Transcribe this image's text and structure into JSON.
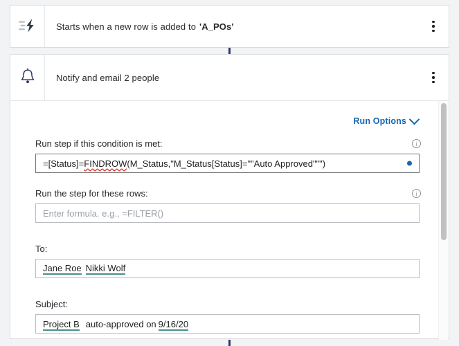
{
  "flow": {
    "steps": [
      {
        "icon": "trigger-bolt-icon",
        "title_prefix": "Starts when a new row is added to",
        "title_bold": "'A_POs'",
        "menu": "more-options"
      },
      {
        "icon": "bell-icon",
        "title_prefix": "Notify and email 2 people",
        "title_bold": "",
        "menu": "more-options"
      }
    ]
  },
  "action_panel": {
    "run_options_label": "Run Options",
    "condition": {
      "label": "Run step if this condition is met:",
      "value_before": "=[Status]=",
      "value_spell": "FINDROW",
      "value_after": "(M_Status,\"M_Status[Status]=\"\"Auto Approved\"\"\")",
      "full_value": "=[Status]=FINDROW(M_Status,\"M_Status[Status]=\"\"Auto Approved\"\"\")",
      "info_tooltip": "info"
    },
    "rows": {
      "label": "Run the step for these rows:",
      "value": "",
      "placeholder": "Enter formula. e.g., =FILTER()",
      "info_tooltip": "info"
    },
    "to": {
      "label": "To:",
      "recipients": [
        "Jane Roe",
        "Nikki Wolf"
      ]
    },
    "subject": {
      "label": "Subject:",
      "token_start": "Project B",
      "middle_text": "auto-approved on",
      "token_end": "9/16/20",
      "full_value": "Project B auto-approved on 9/16/20"
    }
  },
  "colors": {
    "accent_blue": "#1667b1",
    "connector_navy": "#2b3a67",
    "chip_underline": "#4a8f8c",
    "spell_error": "#e8301e"
  }
}
